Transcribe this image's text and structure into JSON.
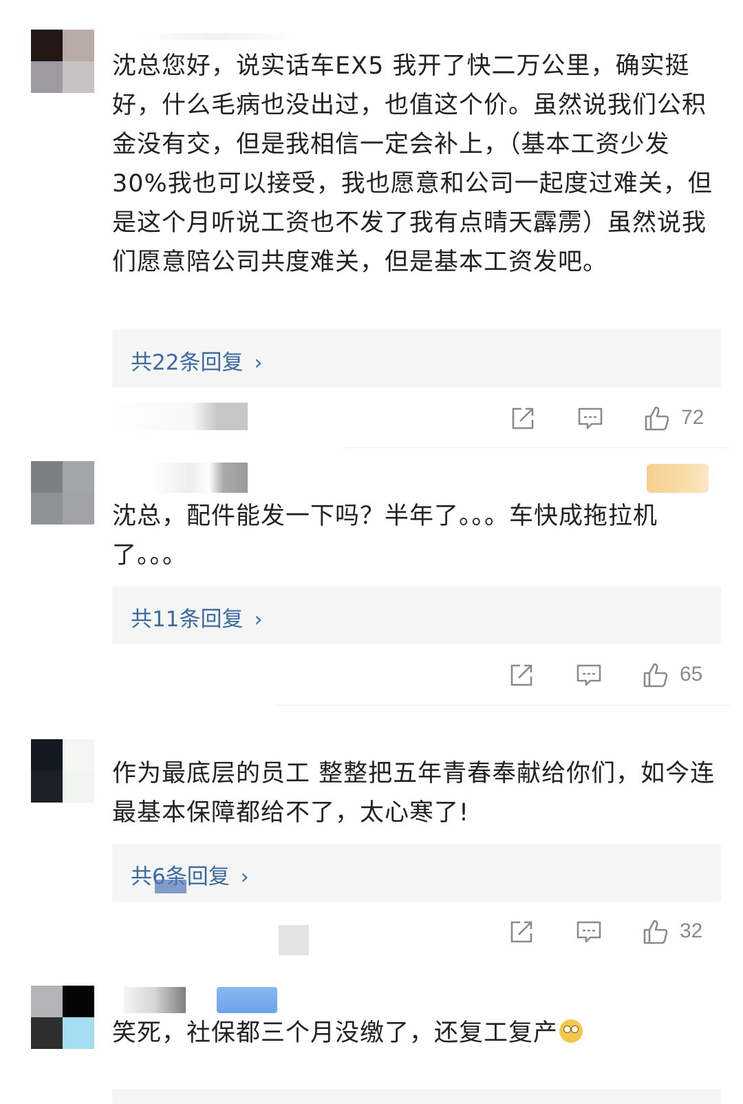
{
  "comments": [
    {
      "text": "沈总您好，说实话车EX5 我开了快二万公里，确实挺好，什么毛病也没出过，也值这个价。虽然说我们公积金没有交，但是我相信一定会补上，（基本工资少发30%我也可以接受，我也愿意和公司一起度过难关，但是这个月听说工资也不发了我有点晴天霹雳）虽然说我们愿意陪公司共度难关，但是基本工资发吧。",
      "replies_label": "共22条回复",
      "like_count": "72",
      "avatar_colors": [
        "#231815",
        "#b9aca6",
        "#9d9aa3",
        "#c9c2c5"
      ]
    },
    {
      "text": "沈总，配件能发一下吗？半年了。。。车快成拖拉机了。。。",
      "replies_label": "共11条回复",
      "like_count": "65",
      "avatar_colors": [
        "#7c7f84",
        "#a3a6a9",
        "#8e9296",
        "#a0a2a5"
      ]
    },
    {
      "text": "作为最底层的员工 整整把五年青春奉献给你们，如今连最基本保障都给不了，太心寒了!",
      "replies_label": "共6条回复",
      "like_count": "32",
      "avatar_colors": [
        "#141a22",
        "#f4f6f3",
        "#1c2129",
        "#f2f4f1"
      ]
    },
    {
      "text": "笑死，社保都三个月没缴了，还复工复产",
      "avatar_colors": [
        "#b3b3b8",
        "#050505",
        "#2e2e2e",
        "#a5def2"
      ]
    }
  ],
  "icons": {
    "share": "share-icon",
    "comment": "comment-icon",
    "like": "thumbs-up-icon",
    "chevron": "chevron-right-icon",
    "emoji": "eye-roll-emoji-icon"
  },
  "colors": {
    "text": "#222222",
    "link": "#3b6aa3",
    "reply_bg": "#f5f5f5",
    "meta_gray": "#8a8a8a"
  }
}
